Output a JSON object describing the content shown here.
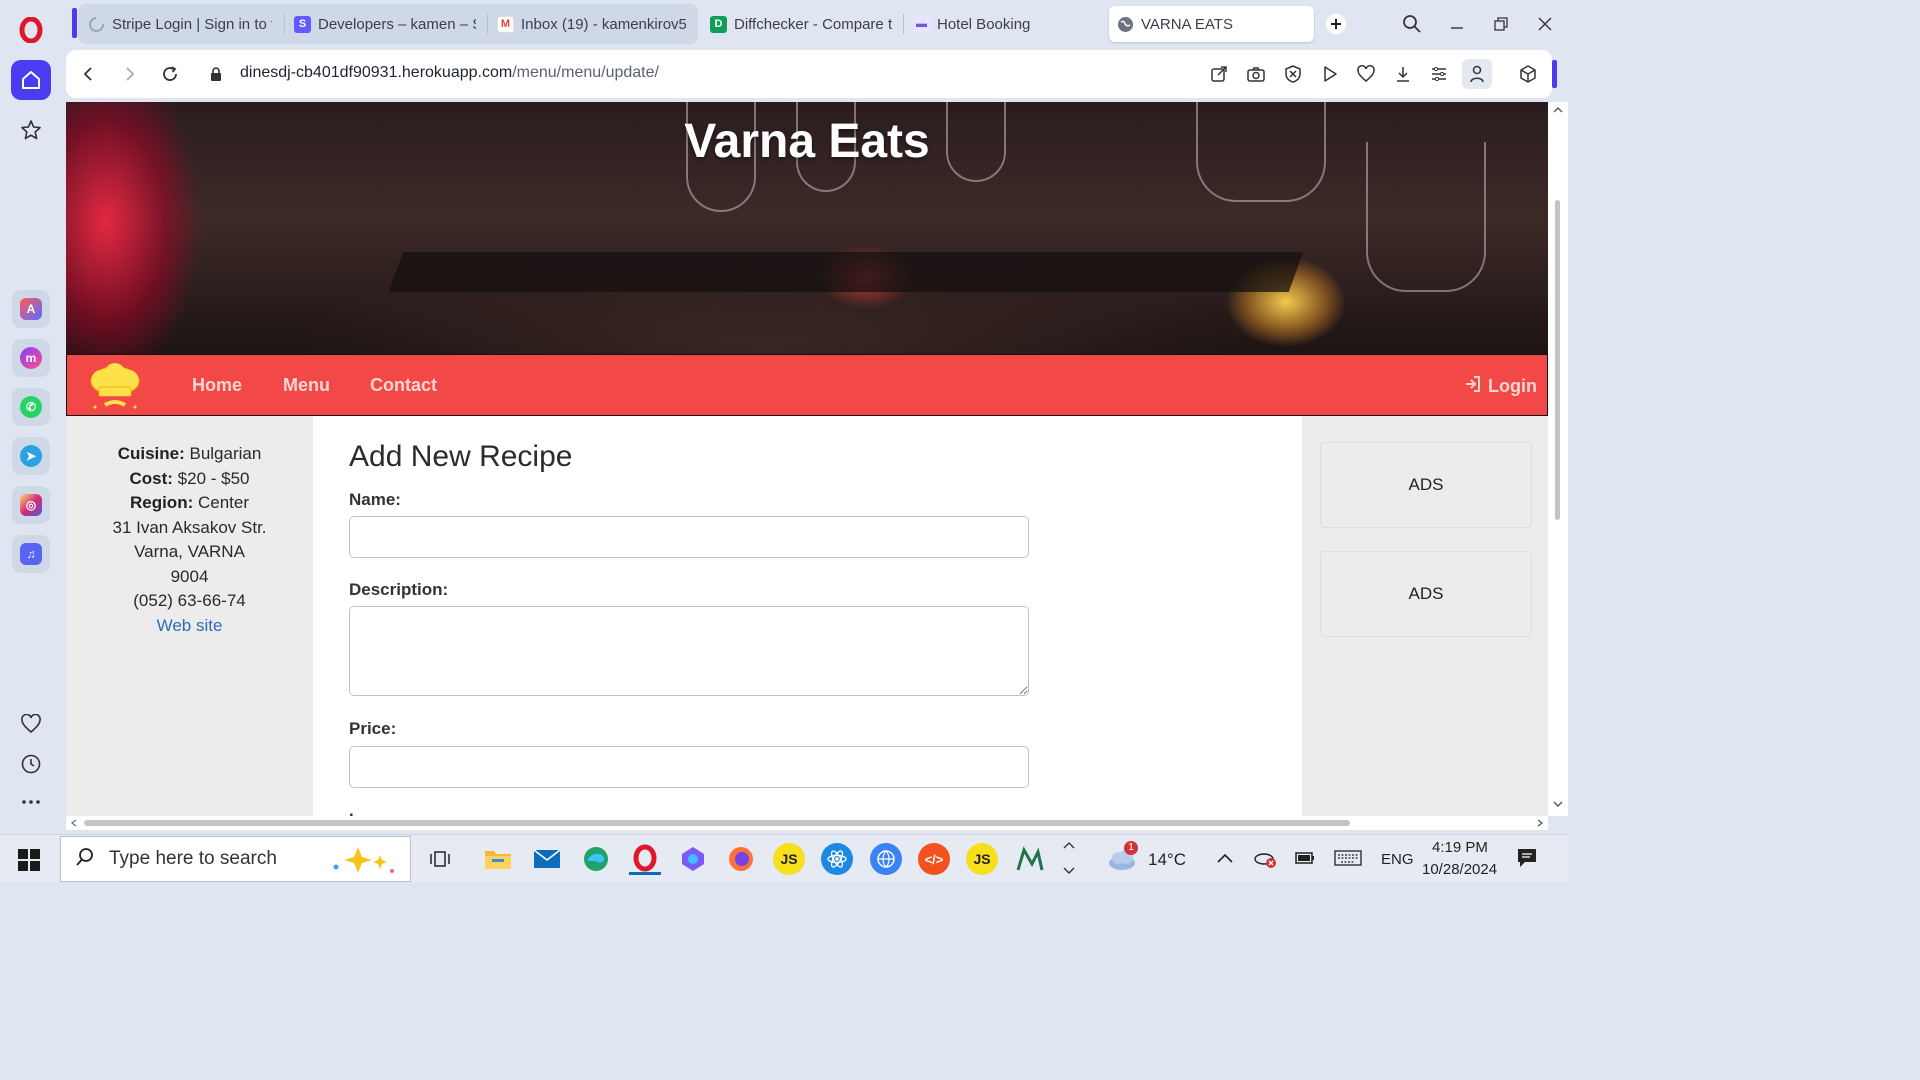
{
  "browser": {
    "tabs": [
      {
        "title": "Stripe Login | Sign in to th",
        "favicon": "spinner-icon",
        "color": "#9aa3b0"
      },
      {
        "title": "Developers – kamen – Stri",
        "favicon": "stripe-icon",
        "color": "#635bff",
        "glyph": "S"
      },
      {
        "title": "Inbox (19) - kamenkirov5",
        "favicon": "gmail-icon",
        "color": "#ea4335",
        "glyph": "M"
      },
      {
        "title": "Diffchecker - Compare te",
        "favicon": "diffchecker-icon",
        "color": "#0f9d58",
        "glyph": "D"
      },
      {
        "title": "Hotel Booking",
        "favicon": "hotel-icon",
        "color": "#6b5bd6",
        "glyph": "•"
      },
      {
        "title": "VARNA EATS",
        "favicon": "globe-icon",
        "color": "#6b7380"
      }
    ],
    "url_host": "dinesdj-cb401df90931.herokuapp.com",
    "url_path": "/menu/menu/update/"
  },
  "site": {
    "title": "Varna Eats",
    "nav": {
      "home": "Home",
      "menu": "Menu",
      "contact": "Contact",
      "login": "Login"
    },
    "accent_color": "#f34848"
  },
  "restaurant": {
    "cuisine_label": "Cuisine:",
    "cuisine": "Bulgarian",
    "cost_label": "Cost:",
    "cost": "$20 - $50",
    "region_label": "Region:",
    "region": "Center",
    "address_line1": "31 Ivan Aksakov Str.",
    "address_line2": "Varna, VARNA",
    "postal_code": "9004",
    "phone": "(052) 63-66-74",
    "website": "Web site"
  },
  "form": {
    "title": "Add New Recipe",
    "name_label": "Name:",
    "name_value": "",
    "description_label": "Description:",
    "description_value": "",
    "price_label": "Price:",
    "price_value": "",
    "next_label_fragment": "."
  },
  "ads": [
    "ADS",
    "ADS"
  ],
  "taskbar": {
    "search_placeholder": "Type here to search",
    "weather": "14°C",
    "weather_badge": "1",
    "language": "ENG",
    "time": "4:19 PM",
    "date": "10/28/2024"
  }
}
